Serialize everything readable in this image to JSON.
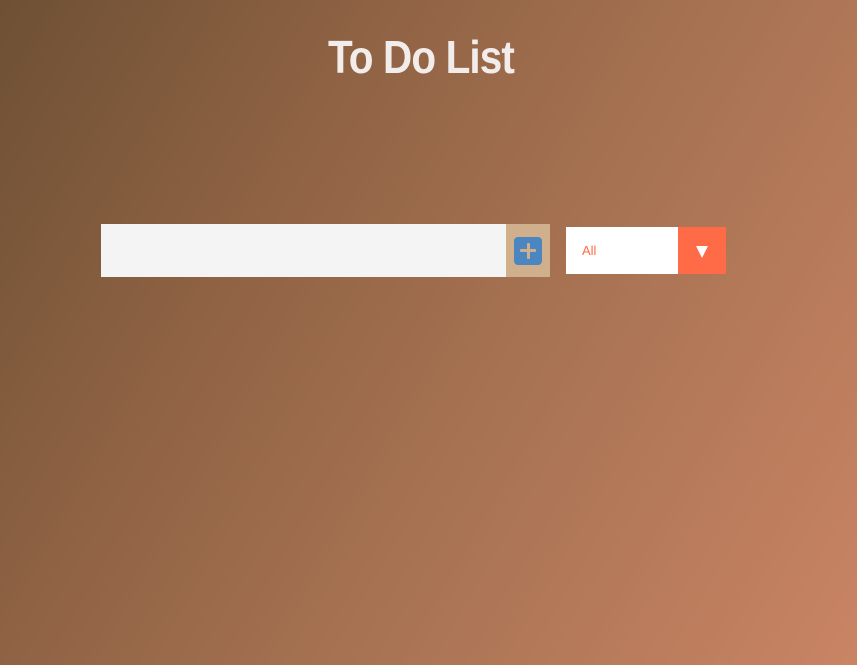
{
  "header": {
    "title": "To Do List"
  },
  "form": {
    "input_value": "",
    "input_placeholder": "",
    "add_button_icon": "plus-icon"
  },
  "filter": {
    "selected": "All",
    "arrow_icon": "chevron-down-icon"
  },
  "todos": [],
  "colors": {
    "input_bg": "#f4f4f4",
    "add_button_bg": "#d0b08c",
    "plus_icon": "#4b86c0",
    "filter_accent": "#ff6b47",
    "title_text": "#f2ecea"
  }
}
